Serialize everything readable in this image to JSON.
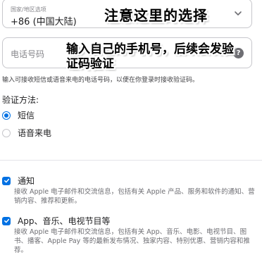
{
  "country": {
    "label": "国家/地区选项",
    "value": "+86 (中国大陆)",
    "annotation": "注意这里的选择"
  },
  "phone": {
    "placeholder": "电话号码",
    "help_glyph": "?",
    "annotation": "输入自己的手机号，后续会发验证码验证"
  },
  "hint": "输入可接收短信或语音来电的电话号码，以便在你登录时接收验证码。",
  "verification": {
    "title": "验证方法:",
    "options": [
      {
        "label": "短信",
        "selected": true
      },
      {
        "label": "语音来电",
        "selected": false
      }
    ]
  },
  "subscriptions": [
    {
      "label": "通知",
      "checked": true,
      "description": "接收 Apple 电子邮件和交流信息，包括有关 Apple 产品、服务和软件的通知、营销内容、推荐和更新。"
    },
    {
      "label": "App、音乐、电视节目等",
      "checked": true,
      "description": "接收 Apple 电子邮件和交流信息，包括有关 App、音乐、电影、电视节目、图书、播客、Apple Pay 等的最新发布情况、独家内容、特别优惠、营销内容和推荐。"
    }
  ],
  "colors": {
    "accent": "#0071e3",
    "text": "#1d1d1f",
    "secondary_text": "#6e6e73",
    "border": "#c7c7cc"
  },
  "icons": {
    "country_chevron": "chevron-down-icon",
    "phone_help": "question-mark-icon",
    "checkbox_mark": "checkmark-icon"
  }
}
